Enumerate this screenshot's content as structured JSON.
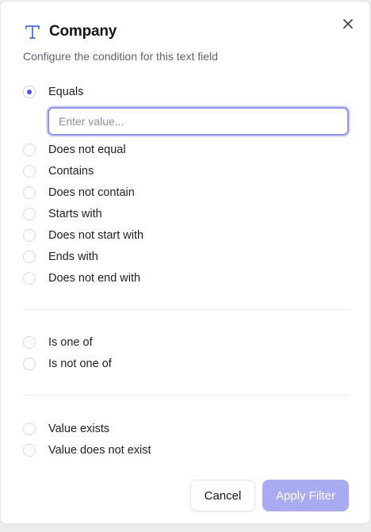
{
  "dialog": {
    "title": "Company",
    "subtitle": "Configure the condition for this text field",
    "field_type_icon": "text-type-icon",
    "close_icon": "close-icon"
  },
  "text_conditions": [
    {
      "label": "Equals",
      "selected": true
    },
    {
      "label": "Does not equal",
      "selected": false
    },
    {
      "label": "Contains",
      "selected": false
    },
    {
      "label": "Does not contain",
      "selected": false
    },
    {
      "label": "Starts with",
      "selected": false
    },
    {
      "label": "Does not start with",
      "selected": false
    },
    {
      "label": "Ends with",
      "selected": false
    },
    {
      "label": "Does not end with",
      "selected": false
    }
  ],
  "value_input": {
    "placeholder": "Enter value...",
    "value": ""
  },
  "list_conditions": [
    {
      "label": "Is one of",
      "selected": false
    },
    {
      "label": "Is not one of",
      "selected": false
    }
  ],
  "existence_conditions": [
    {
      "label": "Value exists",
      "selected": false
    },
    {
      "label": "Value does not exist",
      "selected": false
    }
  ],
  "buttons": {
    "cancel_label": "Cancel",
    "apply_label": "Apply Filter"
  },
  "colors": {
    "accent": "#4b4ee8",
    "apply_button_disabled": "#a8abf2",
    "input_focus_border": "#8e91f0"
  }
}
